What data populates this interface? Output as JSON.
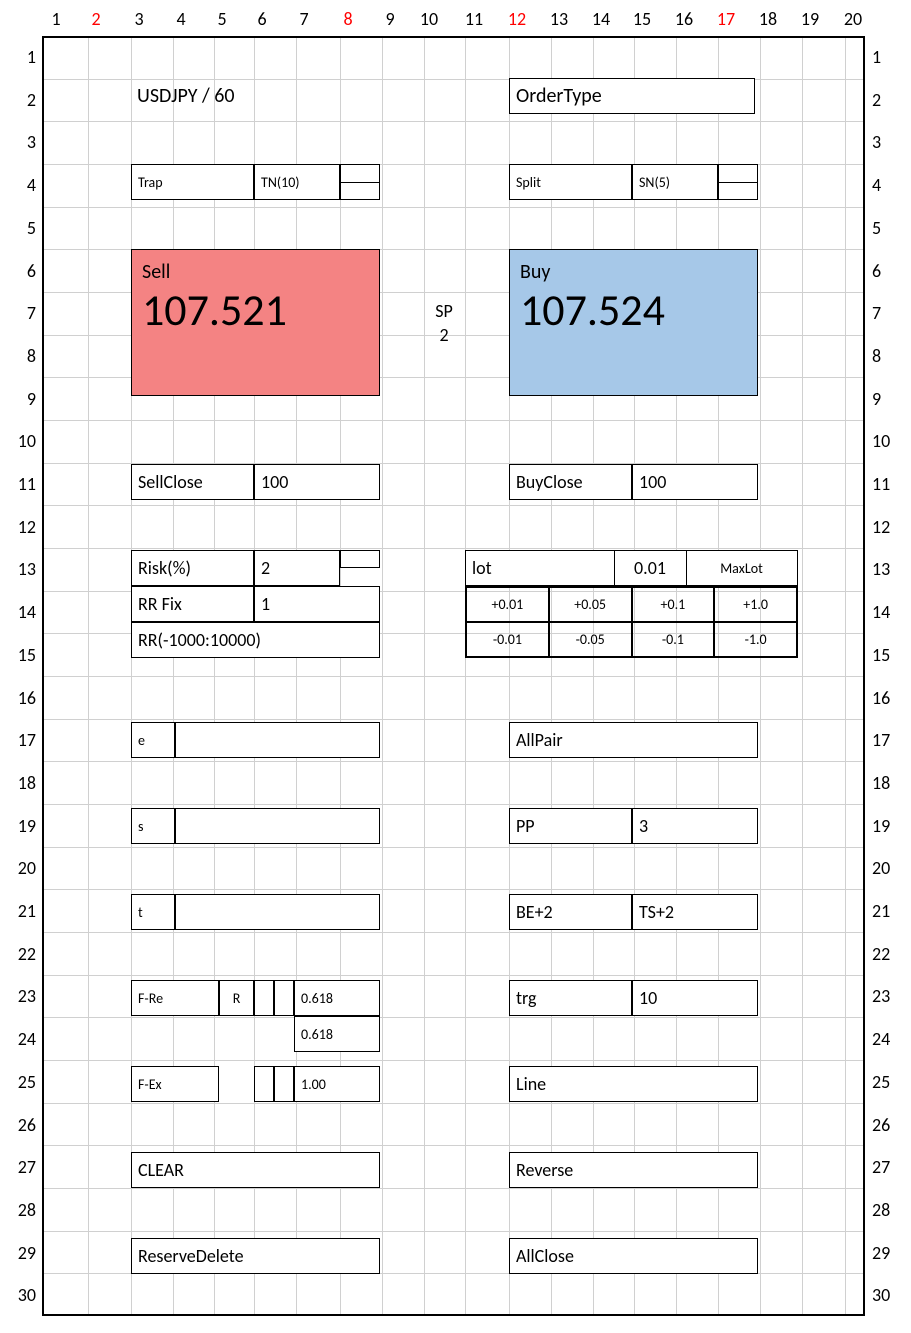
{
  "columns": [
    "1",
    "2",
    "3",
    "4",
    "5",
    "6",
    "7",
    "8",
    "9",
    "10",
    "11",
    "12",
    "13",
    "14",
    "15",
    "16",
    "17",
    "18",
    "19",
    "20"
  ],
  "red_cols": [
    "2",
    "8",
    "12",
    "17"
  ],
  "rows_left": [
    "1",
    "2",
    "3",
    "4",
    "5",
    "6",
    "7",
    "8",
    "9",
    "10",
    "11",
    "12",
    "13",
    "14",
    "15",
    "16",
    "17",
    "18",
    "19",
    "20",
    "21",
    "22",
    "23",
    "24",
    "25",
    "26",
    "27",
    "28",
    "29",
    "30"
  ],
  "rows_right": [
    "1",
    "2",
    "3",
    "4",
    "5",
    "6",
    "7",
    "8",
    "9",
    "10",
    "11",
    "12",
    "13",
    "14",
    "15",
    "16",
    "17",
    "18",
    "19",
    "20",
    "21",
    "22",
    "23",
    "24",
    "25",
    "26",
    "27",
    "28",
    "29",
    "30"
  ],
  "header": {
    "left": "USDJPY / 60",
    "right": "OrderType"
  },
  "trap": {
    "label": "Trap",
    "count": "TN(10)"
  },
  "split": {
    "label": "Split",
    "count": "SN(5)"
  },
  "sell": {
    "label": "Sell",
    "price": "107.521"
  },
  "buy": {
    "label": "Buy",
    "price": "107.524"
  },
  "spread": {
    "label": "SP",
    "value": "2"
  },
  "sellclose": {
    "label": "SellClose",
    "value": "100"
  },
  "buyclose": {
    "label": "BuyClose",
    "value": "100"
  },
  "risk": {
    "label": "Risk(%)",
    "value": "2"
  },
  "rrfix": {
    "label": "RR Fix",
    "value": "1"
  },
  "rr_range": "RR(-1000:10000)",
  "lot": {
    "label": "lot",
    "value": "0.01",
    "maxlot": "MaxLot"
  },
  "lot_plus": [
    "+0.01",
    "+0.05",
    "+0.1",
    "+1.0"
  ],
  "lot_minus": [
    "-0.01",
    "-0.05",
    "-0.1",
    "-1.0"
  ],
  "e_label": "e",
  "s_label": "s",
  "t_label": "t",
  "allpair": "AllPair",
  "pp": {
    "label": "PP",
    "value": "3"
  },
  "be": "BE+2",
  "ts": "TS+2",
  "trg": {
    "label": "trg",
    "value": "10"
  },
  "fre": {
    "label": "F-Re",
    "r": "R",
    "v1": "0.618",
    "v2": "0.618"
  },
  "fex": {
    "label": "F-Ex",
    "v1": "1.00"
  },
  "line_label": "Line",
  "clear": "CLEAR",
  "reverse": "Reverse",
  "reservedelete": "ReserveDelete",
  "allclose": "AllClose"
}
